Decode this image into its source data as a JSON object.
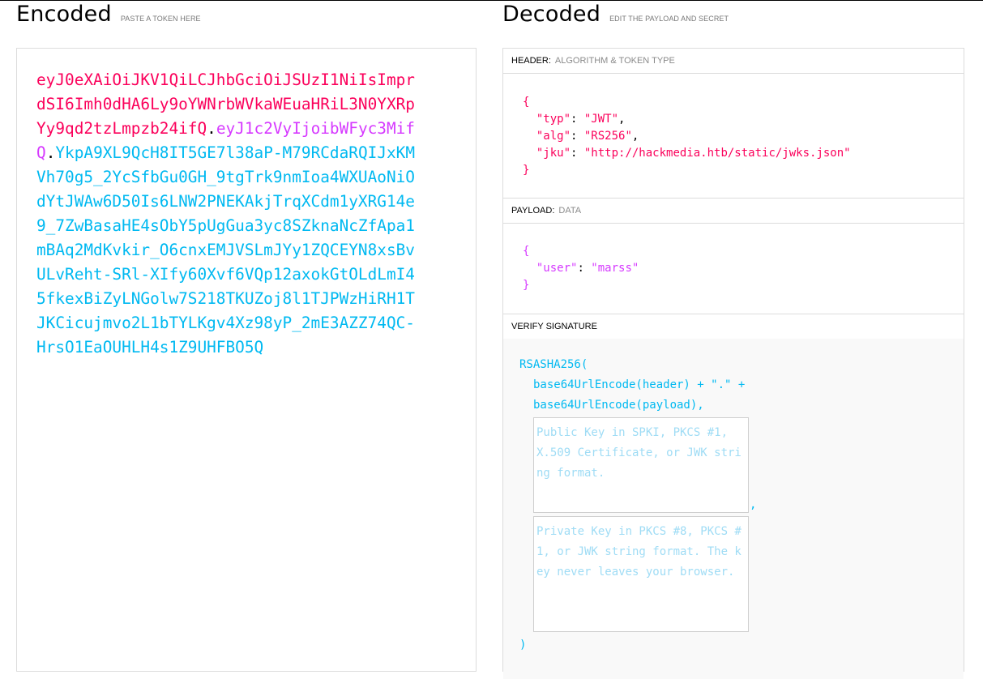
{
  "encoded": {
    "title": "Encoded",
    "subtitle": "PASTE A TOKEN HERE",
    "token_header": "eyJ0eXAiOiJKV1QiLCJhbGciOiJSUzI1NiIsImprdSI6Imh0dHA6Ly9oYWNrbWVkaWEuaHRiL3N0YXRpYy9qd2tzLmpzb24ifQ",
    "token_payload": "eyJ1c2VyIjoibWFyc3MifQ",
    "token_signature": "YkpA9XL9QcH8IT5GE7l38aP-M79RCdaRQIJxKMVh70g5_2YcSfbGu0GH_9tgTrk9nmIoa4WXUAoNiOdYtJWAw6D50Is6LNW2PNEKAkjTrqXCdm1yXRG14e9_7ZwBasaHE4sObY5pUgGua3yc8SZknaNcZfApa1mBAq2MdKvkir_O6cnxEMJVSLmJYy1ZQCEYN8xsBvULvReht-SRl-XIfy60Xvf6VQp12axokGtOLdLmI45fkexBiZyLNGolw7S218TKUZoj8l1TJPWzHiRH1TJKCicujmvo2L1bTYLKgv4Xz98yP_2mE3AZZ74QC-HrsO1EaOUHLH4s1Z9UHFBO5Q",
    "dot": "."
  },
  "decoded": {
    "title": "Decoded",
    "subtitle": "EDIT THE PAYLOAD AND SECRET",
    "header_section": {
      "label": "HEADER:",
      "desc": "ALGORITHM & TOKEN TYPE",
      "open": "{",
      "close": "}",
      "typ_key": "\"typ\"",
      "typ_val": "\"JWT\"",
      "alg_key": "\"alg\"",
      "alg_val": "\"RS256\"",
      "jku_key": "\"jku\"",
      "jku_val": "\"http://hackmedia.htb/static/jwks.json\""
    },
    "payload_section": {
      "label": "PAYLOAD:",
      "desc": "DATA",
      "open": "{",
      "close": "}",
      "user_key": "\"user\"",
      "user_val": "\"marss\""
    },
    "verify_section": {
      "label": "VERIFY SIGNATURE",
      "line1": "RSASHA256(",
      "line2": "base64UrlEncode(header) + \".\" +",
      "line3": "base64UrlEncode(payload),",
      "public_key_placeholder": "Public Key in SPKI, PKCS #1, X.509 Certificate, or JWK string format.",
      "comma": ",",
      "private_key_placeholder": "Private Key in PKCS #8, PKCS #1, or JWK string format. The key never leaves your browser.",
      "close": ")"
    }
  },
  "colors": {
    "header": "#fb015b",
    "payload": "#d63aff",
    "signature": "#00b9f1"
  }
}
